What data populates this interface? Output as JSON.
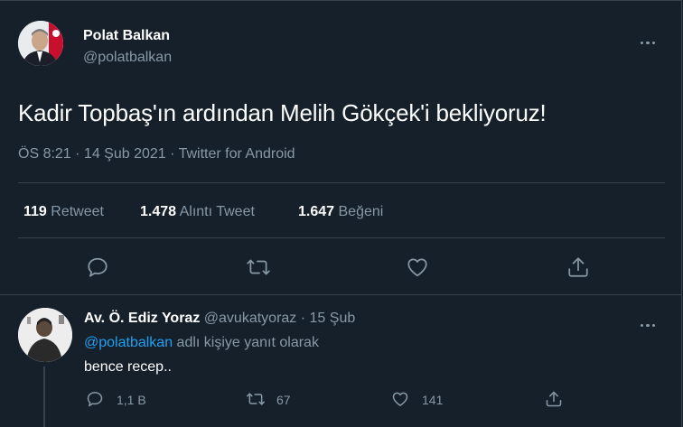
{
  "tweet": {
    "author_name": "Polat Balkan",
    "author_handle": "@polatbalkan",
    "text": "Kadir Topbaş'ın ardından Melih Gökçek'i bekliyoruz!",
    "timestamp": "ÖS 8:21 · 14 Şub 2021 · Twitter for Android",
    "stats": {
      "retweets_count": "119",
      "retweets_label": "Retweet",
      "quotes_count": "1.478",
      "quotes_label": "Alıntı Tweet",
      "likes_count": "1.647",
      "likes_label": "Beğeni"
    },
    "actions": [
      "reply-icon",
      "retweet-icon",
      "like-icon",
      "share-icon"
    ]
  },
  "reply": {
    "author_name": "Av. Ö. Ediz Yoraz",
    "author_handle": "@avukatyoraz",
    "separator": "·",
    "date": "15 Şub",
    "replying_to_handle": "@polatbalkan",
    "replying_to_suffix": "adlı kişiye yanıt olarak",
    "text": "bence recep..",
    "reply_count": "1,1 B",
    "retweet_count": "67",
    "like_count": "141"
  },
  "colors": {
    "background": "#15202b",
    "border": "#38444d",
    "muted": "#8899a6",
    "link": "#1da1f2",
    "text": "#ffffff"
  }
}
